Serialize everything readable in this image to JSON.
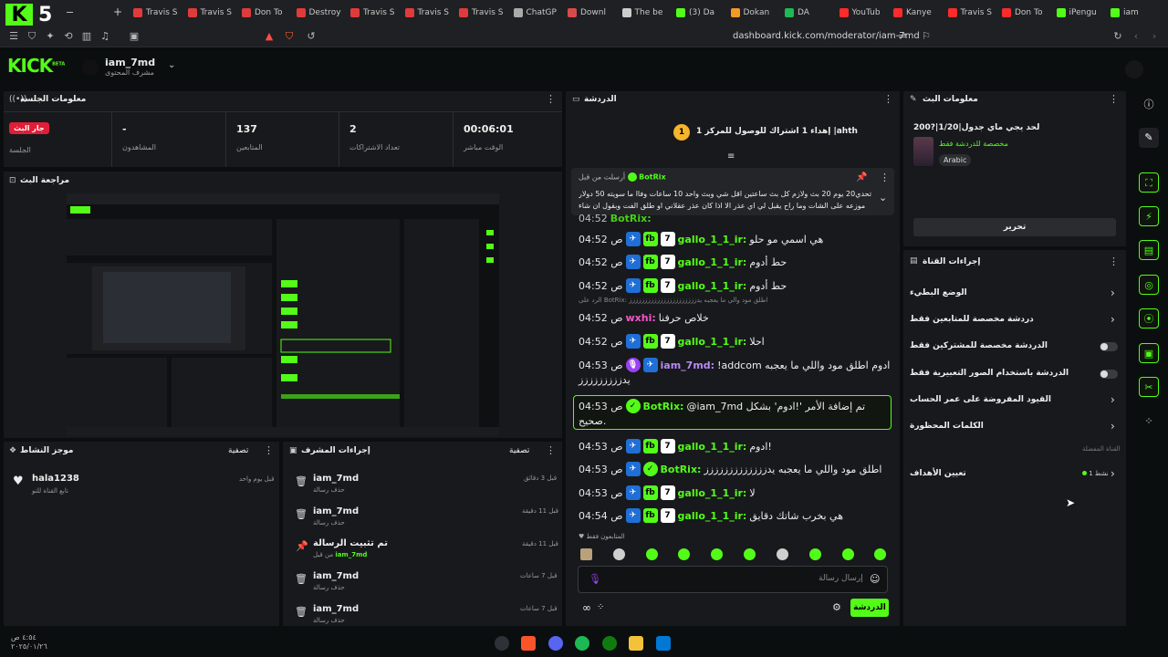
{
  "browser": {
    "tabs": [
      {
        "label": "Travis S",
        "color": "#e03b3b"
      },
      {
        "label": "Travis S",
        "color": "#e03b3b"
      },
      {
        "label": "Don To",
        "color": "#e03b3b"
      },
      {
        "label": "Destroy",
        "color": "#e03b3b"
      },
      {
        "label": "Travis S",
        "color": "#e03b3b"
      },
      {
        "label": "Travis S",
        "color": "#e03b3b"
      },
      {
        "label": "Travis S",
        "color": "#e03b3b"
      },
      {
        "label": "ChatGP",
        "color": "#aaaaaa"
      },
      {
        "label": "Downl",
        "color": "#d94a4a"
      },
      {
        "label": "The be",
        "color": "#cccccc"
      },
      {
        "label": "(3) Da",
        "color": "#53fc18"
      },
      {
        "label": "Dokan",
        "color": "#f29a24"
      },
      {
        "label": "DA",
        "color": "#1db954"
      },
      {
        "label": "YouTub",
        "color": "#ff2b2b"
      },
      {
        "label": "Kanye",
        "color": "#ff2b2b"
      },
      {
        "label": "Travis S",
        "color": "#ff2b2b"
      },
      {
        "label": "Don To",
        "color": "#ff2b2b"
      },
      {
        "label": "iPengu",
        "color": "#53fc18"
      },
      {
        "label": "iam",
        "color": "#53fc18"
      }
    ],
    "url": "dashboard.kick.com/moderator/iam-7md"
  },
  "header": {
    "logo": "KICK",
    "logo_sup": "BETA",
    "username": "iam_7md",
    "subtitle": "مشرف المحتوى"
  },
  "session": {
    "title": "معلومات الجلسة",
    "live_badge": "جار البث",
    "stats": [
      {
        "label": "الجلسة",
        "value": ""
      },
      {
        "label": "المشاهدون",
        "value": "-"
      },
      {
        "label": "المتابعين",
        "value": "137"
      },
      {
        "label": "تعداد الاشتراكات",
        "value": "2"
      },
      {
        "label": "الوقت مباشر",
        "value": "00:06:01"
      }
    ]
  },
  "preview": {
    "title": "مراجعة البث"
  },
  "activity": {
    "title": "موجز النشاط",
    "filter": "تصفية",
    "items": [
      {
        "name": "hala1238",
        "sub": "تابع القناة للتو",
        "time": "قبل يوم واحد"
      }
    ]
  },
  "mod_actions": {
    "title": "إجراءات المشرف",
    "filter": "تصفية",
    "items": [
      {
        "name": "iam_7md",
        "sub": "حذف رسالة",
        "time": "قبل 3 دقائق",
        "icon": "trash-icon"
      },
      {
        "name": "iam_7md",
        "sub": "حذف رسالة",
        "time": "قبل 11 دقيقة",
        "icon": "trash-icon"
      },
      {
        "name": "تم تثبيت الرسالة",
        "sub": "من قبل",
        "sub_user": "iam_7md",
        "time": "قبل 11 دقيقة",
        "icon": "pin-icon"
      },
      {
        "name": "iam_7md",
        "sub": "حذف رسالة",
        "time": "قبل 7 ساعات",
        "icon": "trash-icon"
      },
      {
        "name": "iam_7md",
        "sub": "حذف رسالة",
        "time": "قبل 7 ساعات",
        "icon": "trash-icon"
      }
    ]
  },
  "chat": {
    "title": "الدردشة",
    "goal_text": "إهداء 1 اشتراك للوصول للمركز 1 |ahth",
    "goal_rank": "1",
    "pinned": {
      "header": "أرسلت من قبل",
      "user": "BotRix",
      "text": "تحدي20 يوم 20 بث ولازم كل بث ساعتين اقل شي وبث واحد 10 ساعات وفاا ما سويته 50 دولار موزعه على الشات وما راح يقبل لي اي عذر الا اذا كان عذر عقلاني او طلق الفت وبقول ان شاء الله"
    },
    "behind_text": "BotRix:",
    "messages": [
      {
        "time": "04:52 ص",
        "user": "gallo_1_1_ir:",
        "text": "هي اسمي مو حلو",
        "badges": [
          "blue",
          "green",
          "white"
        ]
      },
      {
        "time": "04:52 ص",
        "user": "gallo_1_1_ir:",
        "text": "حط أدوم",
        "badges": [
          "blue",
          "green",
          "white"
        ]
      },
      {
        "time": "04:52 ص",
        "user": "gallo_1_1_ir:",
        "text": "حط أدوم",
        "badges": [
          "blue",
          "green",
          "white"
        ]
      },
      {
        "time": "04:52 ص",
        "user": "wxhi:",
        "text": "خلاص حرفنا",
        "badges": [],
        "color": "pink",
        "reply": "الرد على BotRix: اطلق مود والي ما يعجبه يدزززززززززززززززززززززز"
      },
      {
        "time": "04:52 ص",
        "user": "gallo_1_1_ir:",
        "text": "احلا",
        "badges": [
          "blue",
          "green",
          "white"
        ]
      },
      {
        "time": "04:53 ص",
        "user": "iam_7md:",
        "text": "!addcom ادوم اطلق مود واللي ما يعجبه",
        "text2": "يدززززززززز",
        "badges": [
          "purple",
          "blue"
        ],
        "color": "purple"
      },
      {
        "time": "04:53 ص",
        "user": "BotRix:",
        "text": "@iam_7md تم إضافة الأمر '!ادوم' بشكل",
        "text2": "صحيح.",
        "badges": [
          "bot"
        ],
        "highlight": true
      },
      {
        "time": "04:53 ص",
        "user": "gallo_1_1_ir:",
        "text": "ادوم!",
        "badges": [
          "blue",
          "green",
          "white"
        ]
      },
      {
        "time": "04:53 ص",
        "user": "BotRix:",
        "text": "اطلق مود واللي ما يعجبه يدززززززززززززز",
        "badges": [
          "blue",
          "bot"
        ]
      },
      {
        "time": "04:53 ص",
        "user": "gallo_1_1_ir:",
        "text": "لا",
        "badges": [
          "blue",
          "green",
          "white"
        ]
      },
      {
        "time": "04:54 ص",
        "user": "gallo_1_1_ir:",
        "text": "هي بخرب شاتك دقايق",
        "badges": [
          "blue",
          "green",
          "white"
        ]
      }
    ],
    "followers_only": "المتابعون فقط",
    "input_placeholder": "إرسال رسالة",
    "send_label": "الدردشة"
  },
  "stream_info": {
    "title": "معلومات البث",
    "stream_title": "لحد يجي ماي جدول|1/20|?200",
    "category": "مخصصة للدردشة فقط",
    "language": "Arabic",
    "edit_label": "تحرير"
  },
  "channel_actions": {
    "title": "إجراءات القناة",
    "items": [
      {
        "label": "الوضع البطيء",
        "control": "chevron"
      },
      {
        "label": "دردشة مخصصة للمتابعين فقط",
        "control": "chevron"
      },
      {
        "label": "الدردشة مخصصة للمشتركين فقط",
        "control": "toggle"
      },
      {
        "label": "الدردشة باستخدام الصور التعبيرية فقط",
        "control": "toggle"
      },
      {
        "label": "القيود المفروضة على عمر الحساب",
        "control": "chevron"
      },
      {
        "label": "الكلمات المحظورة",
        "control": "chevron"
      }
    ],
    "section_label": "القناة المفضلة",
    "goals_label": "تعيين الأهداف",
    "goals_status": "1 نشط"
  },
  "taskbar": {
    "time": "٤:٥٤ ص",
    "date": "٢٠٢٥/٠١/٢٦"
  },
  "colors": {
    "accent": "#53fc18",
    "panel": "#18191c",
    "background": "#0b0e0f",
    "live": "#e01e37"
  }
}
